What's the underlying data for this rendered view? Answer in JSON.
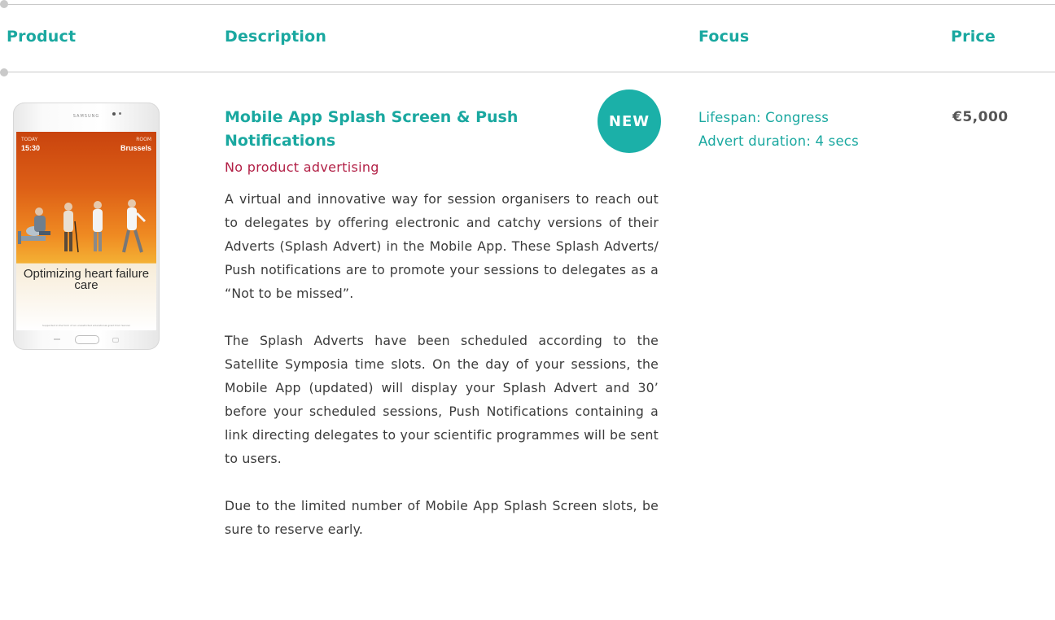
{
  "header": {
    "product": "Product",
    "description": "Description",
    "focus": "Focus",
    "price": "Price"
  },
  "product": {
    "image": {
      "brand": "SAMSUNG",
      "today_label": "TODAY",
      "time": "15:30",
      "room_label": "ROOM",
      "room": "Brussels",
      "headline": "Optimizing heart failure care",
      "footer": "Supported in the form of an unrestricted educational grant from Servier"
    },
    "title": "Mobile App Splash Screen & Push Notifications",
    "badge": "NEW",
    "restriction": "No product advertising",
    "paragraphs": [
      "A virtual and innovative way for session organisers to reach out to delegates by offering electronic and catchy versions of their Adverts (Splash Advert) in the Mobile App. These Splash Adverts/ Push notifications are to promote your sessions to delegates as a “Not to be missed”.",
      "The Splash Adverts have been scheduled according to the Satellite Symposia time slots. On the day of your sessions, the Mobile App (updated) will display your Splash Advert and 30’ before your scheduled sessions, Push Notifications containing a link directing delegates to your scientific programmes will be sent to users.",
      "Due to the limited number of Mobile App Splash Screen slots, be sure to reserve early."
    ],
    "focus": {
      "lifespan": "Lifespan: Congress",
      "duration": "Advert duration: 4 secs"
    },
    "price": "€5,000"
  },
  "colors": {
    "accent": "#1aa8a0",
    "badge": "#1bb0a8",
    "restriction": "#b22046",
    "rule": "#c9c9c9"
  }
}
